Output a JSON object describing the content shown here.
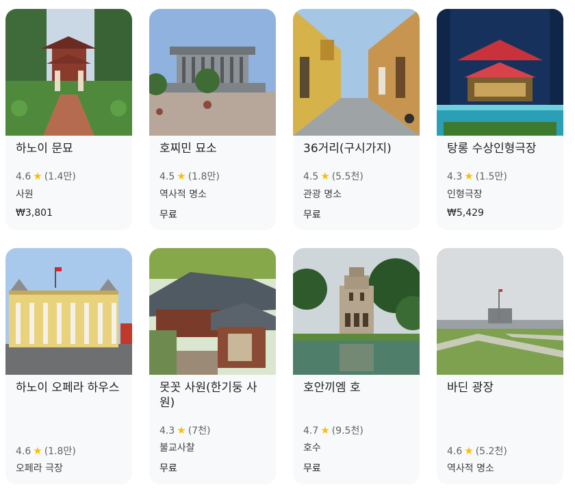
{
  "places": [
    {
      "title": "하노이 문묘",
      "rating": "4.6",
      "reviews": "(1.4만)",
      "category": "사원",
      "price": "₩3,801"
    },
    {
      "title": "호찌민 묘소",
      "rating": "4.5",
      "reviews": "(1.8만)",
      "category": "역사적 명소",
      "price": "무료"
    },
    {
      "title": "36거리(구시가지)",
      "rating": "4.5",
      "reviews": "(5.5천)",
      "category": "관광 명소",
      "price": "무료"
    },
    {
      "title": "탕롱 수상인형극장",
      "rating": "4.3",
      "reviews": "(1.5만)",
      "category": "인형극장",
      "price": "₩5,429"
    },
    {
      "title": "하노이 오페라 하우스",
      "rating": "4.6",
      "reviews": "(1.8만)",
      "category": "오페라 극장"
    },
    {
      "title": "못꼿 사원(한기둥 사원)",
      "rating": "4.3",
      "reviews": "(7천)",
      "category": "불교사찰",
      "price": "무료"
    },
    {
      "title": "호안끼엠 호",
      "rating": "4.7",
      "reviews": "(9.5천)",
      "category": "호수",
      "price": "무료"
    },
    {
      "title": "바딘 광장",
      "rating": "4.6",
      "reviews": "(5.2천)",
      "category": "역사적 명소"
    }
  ],
  "icons": {
    "rating": "star-icon"
  },
  "colors": {
    "star": "#fbbc04",
    "card_bg": "#f8f9fa",
    "title": "#202124",
    "secondary": "#5f6368"
  }
}
